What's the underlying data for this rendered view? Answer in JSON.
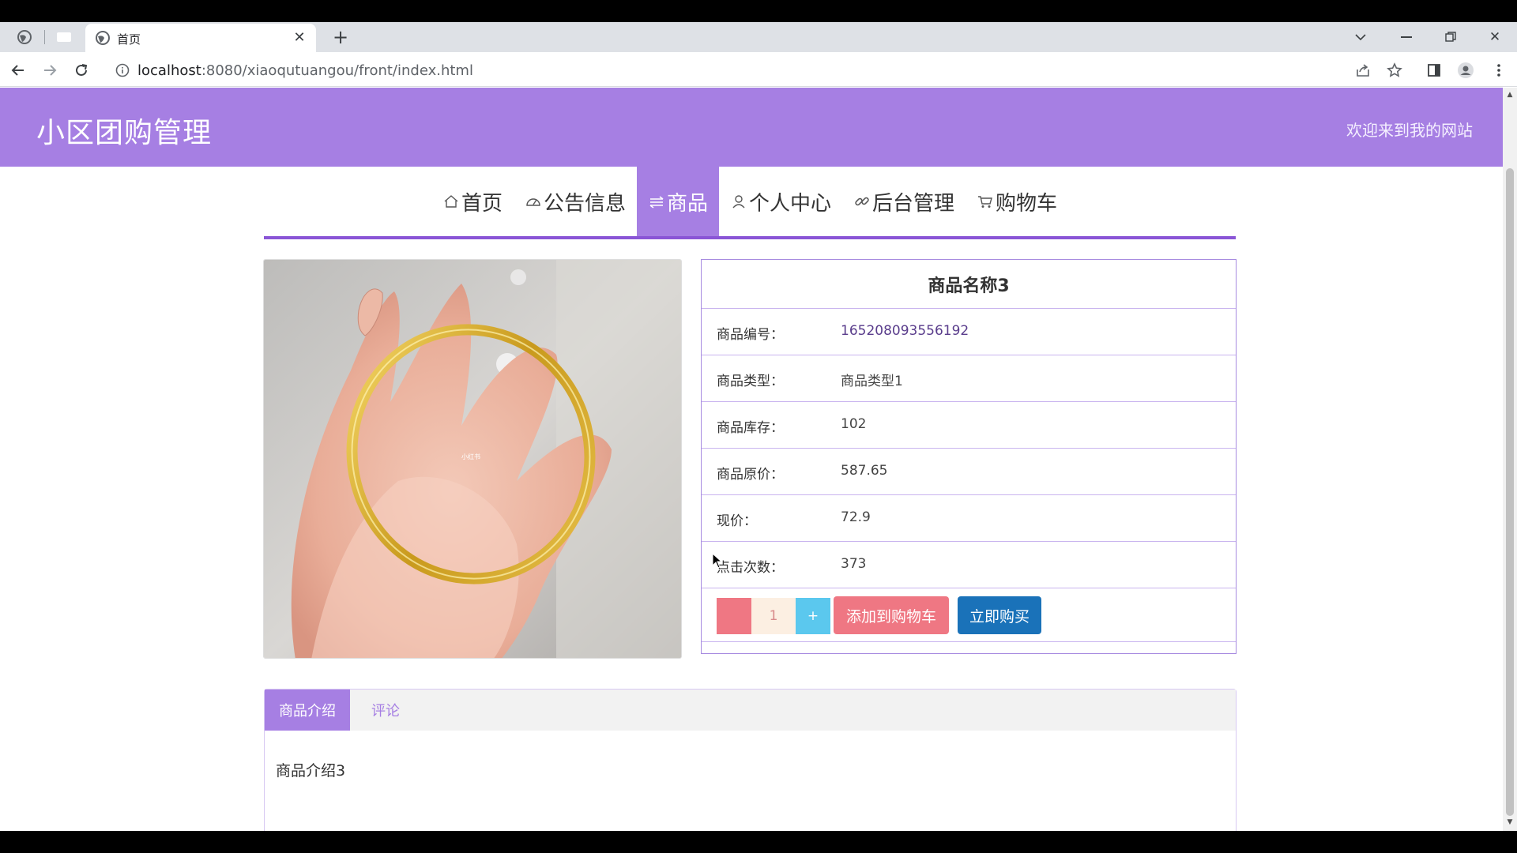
{
  "browser": {
    "tab_title": "首页",
    "url_host": "localhost",
    "url_rest": ":8080/xiaoqutuangou/front/index.html"
  },
  "site": {
    "title": "小区团购管理",
    "welcome": "欢迎来到我的网站"
  },
  "nav": {
    "items": [
      {
        "label": "首页",
        "icon": "home-icon"
      },
      {
        "label": "公告信息",
        "icon": "gauge-icon"
      },
      {
        "label": "商品",
        "icon": "menu-lines-icon"
      },
      {
        "label": "个人中心",
        "icon": "user-icon"
      },
      {
        "label": "后台管理",
        "icon": "link-icon"
      },
      {
        "label": "购物车",
        "icon": "cart-icon"
      }
    ],
    "active_index": 2
  },
  "product": {
    "name": "商品名称3",
    "image_watermark": "小红书",
    "fields": [
      {
        "label": "商品编号：",
        "value": "165208093556192"
      },
      {
        "label": "商品类型：",
        "value": "商品类型1"
      },
      {
        "label": "商品库存：",
        "value": "102"
      },
      {
        "label": "商品原价：",
        "value": "587.65"
      },
      {
        "label": "现价：",
        "value": "72.9"
      },
      {
        "label": "点击次数：",
        "value": "373"
      }
    ],
    "quantity": "1",
    "plus_label": "+",
    "add_to_cart_label": "添加到购物车",
    "buy_now_label": "立即购买"
  },
  "details": {
    "tabs": [
      "商品介绍",
      "评论"
    ],
    "active_tab": 0,
    "content": "商品介绍3"
  },
  "colors": {
    "brand_purple": "#a67fe3",
    "cart_red": "#ef7783",
    "buy_blue": "#1a72b9",
    "plus_cyan": "#5bc8ee"
  }
}
